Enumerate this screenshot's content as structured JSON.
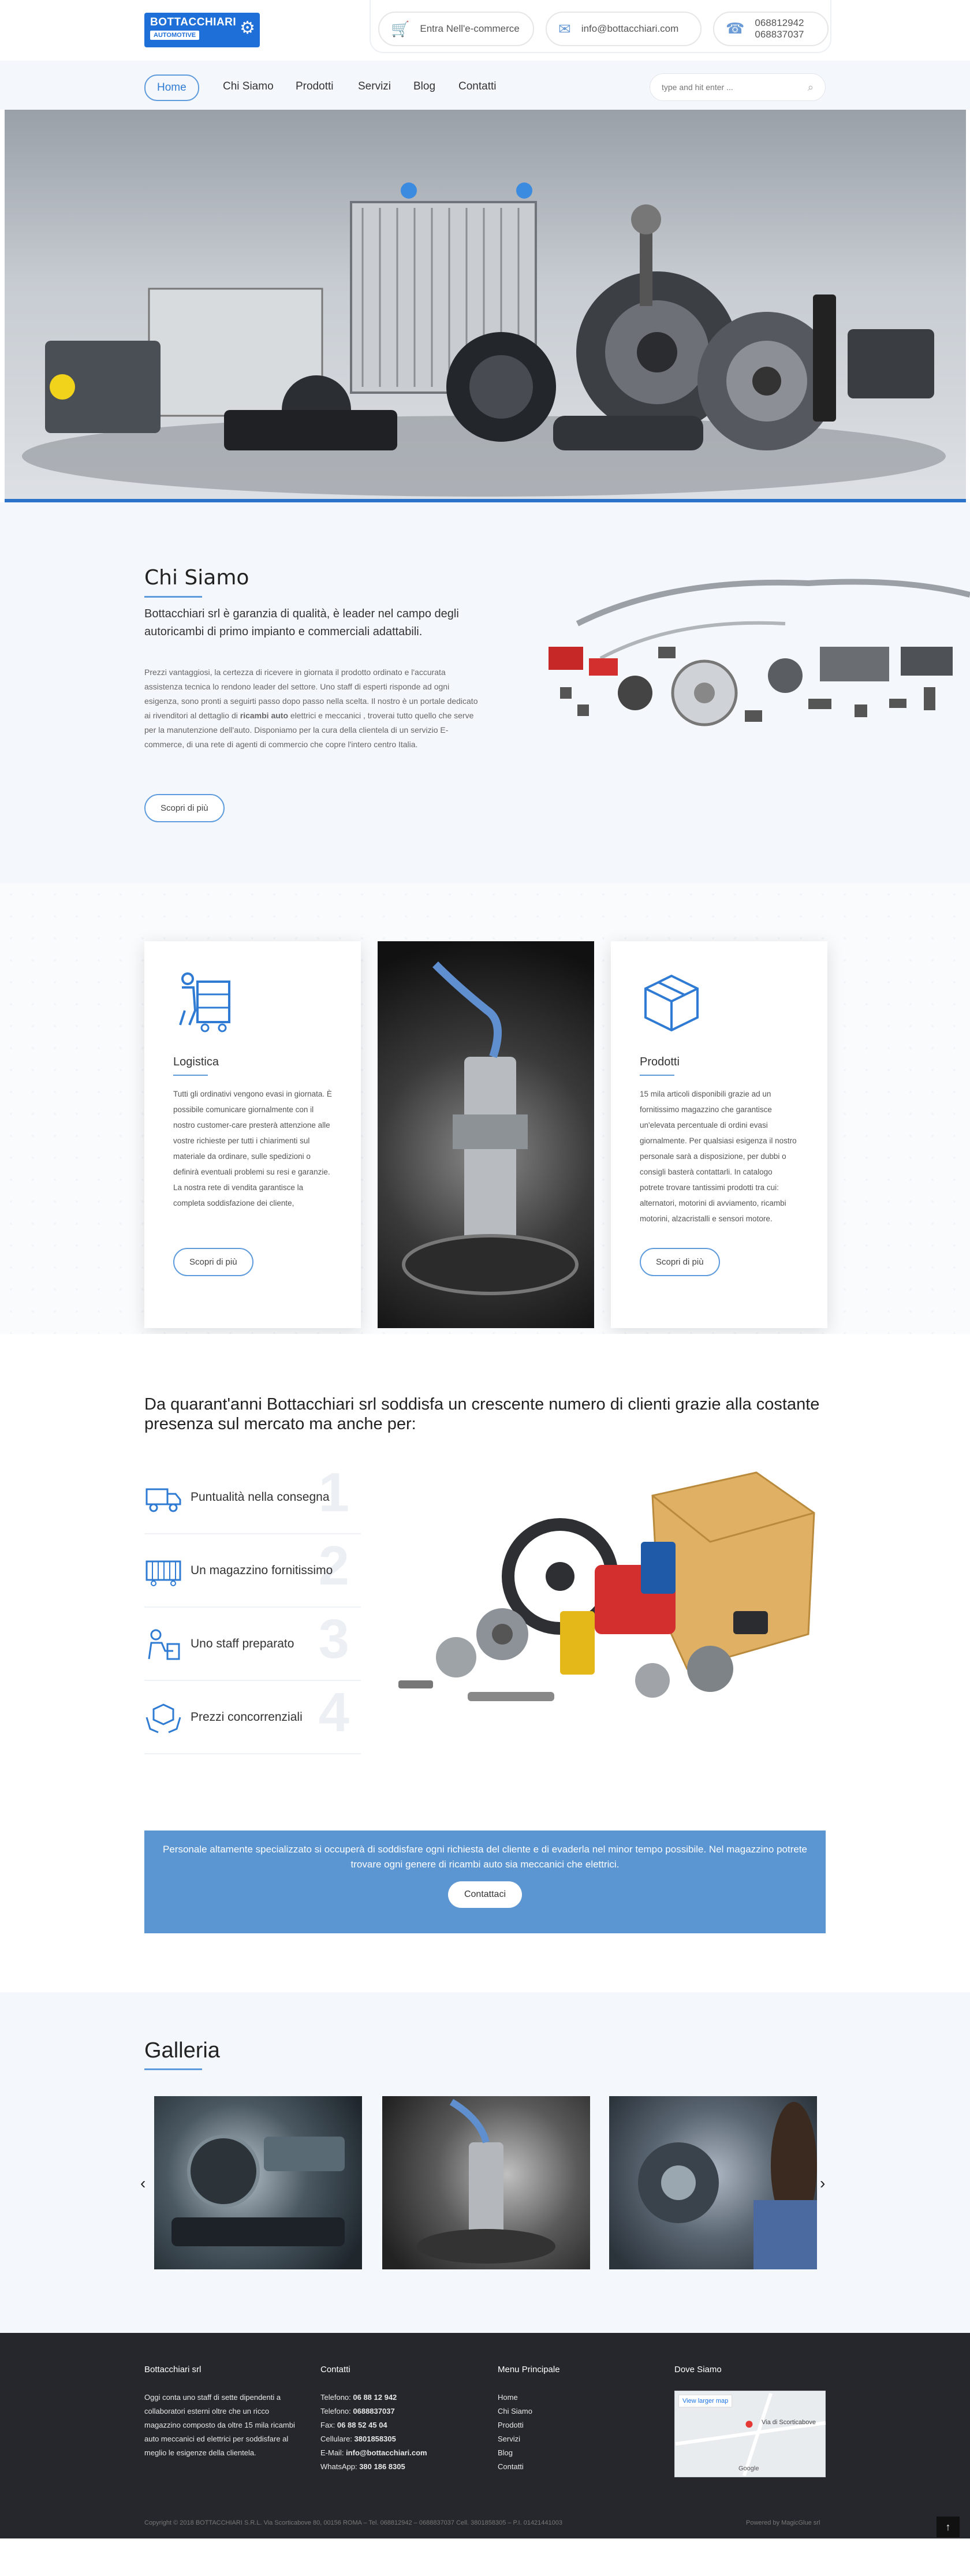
{
  "header": {
    "logo_line1": "BOTTACCHIARI",
    "logo_line2": "AUTOMOTIVE",
    "ecommerce_label": "Entra Nell'e-commerce",
    "email_label": "info@bottacchiari.com",
    "phone1": "068812942",
    "phone2": "068837037"
  },
  "nav": {
    "items": [
      "Home",
      "Chi Siamo",
      "Prodotti",
      "Servizi",
      "Blog",
      "Contatti"
    ],
    "search_placeholder": "type and hit enter ..."
  },
  "about": {
    "title": "Chi Siamo",
    "lead": "Bottacchiari srl è garanzia di qualità, è leader nel campo degli autoricambi di primo impianto e commerciali adattabili.",
    "body_start": "Prezzi vantaggiosi, la certezza di ricevere in giornata il prodotto ordinato e l'accurata assistenza tecnica lo rendono leader del settore. Uno staff di esperti risponde ad ogni esigenza, sono pronti a seguirti passo dopo passo nella scelta. Il nostro è un portale dedicato ai rivenditori al dettaglio di ",
    "body_bold": "ricambi auto",
    "body_end": " elettrici e meccanici , troverai tutto quello che serve per la manutenzione dell'auto. Disponiamo per la cura della clientela di un servizio E-commerce, di una rete di agenti di commercio che copre l'intero centro Italia.",
    "button": "Scopri di più"
  },
  "features": {
    "card1": {
      "title": "Logistica",
      "text": "Tutti gli ordinativi vengono evasi in giornata. È possibile comunicare giornalmente con il nostro customer-care presterà attenzione alle vostre richieste per tutti i chiarimenti sul materiale da ordinare, sulle spedizioni o definirà eventuali problemi su resi e garanzie. La nostra rete di vendita garantisce la completa soddisfazione dei cliente,",
      "button": "Scopri di più"
    },
    "card3": {
      "title": "Prodotti",
      "text": "15 mila articoli disponibili grazie ad un fornitissimo magazzino che garantisce un'elevata percentuale di ordini evasi giornalmente. Per qualsiasi esigenza il nostro personale sarà a disposizione, per dubbi o consigli basterà contattarli. In catalogo potrete trovare tantissimi prodotti tra cui: alternatori, motorini di avviamento, ricambi motorini, alzacristalli e sensori motore.",
      "button": "Scopri di più"
    }
  },
  "why": {
    "title": "Da quarant'anni Bottacchiari srl soddisfa un crescente numero di clienti grazie alla costante presenza sul mercato ma anche per:",
    "items": [
      {
        "label": "Puntualità nella consegna",
        "num": "1",
        "icon": "truck-icon"
      },
      {
        "label": "Un magazzino fornitissimo",
        "num": "2",
        "icon": "warehouse-icon"
      },
      {
        "label": "Uno staff preparato",
        "num": "3",
        "icon": "staff-icon"
      },
      {
        "label": "Prezzi concorrenziali",
        "num": "4",
        "icon": "box-hands-icon"
      }
    ]
  },
  "cta": {
    "text": "Personale altamente specializzato si occuperà di soddisfare ogni richiesta del cliente e di evaderla nel minor tempo possibile. Nel magazzino potrete trovare ogni genere di ricambi auto sia meccanici che elettrici.",
    "button": "Contattaci"
  },
  "gallery": {
    "title": "Galleria"
  },
  "footer": {
    "col1_title": "Bottacchiari srl",
    "col1_text": "Oggi conta uno staff di sette dipendenti a collaboratori esterni oltre che un ricco magazzino composto da oltre 15 mila ricambi auto meccanici ed elettrici per soddisfare al meglio le esigenze della clientela.",
    "col2_title": "Contatti",
    "contacts": [
      {
        "label": "Telefono: ",
        "value": "06 88 12 942"
      },
      {
        "label": "Telefono: ",
        "value": "0688837037"
      },
      {
        "label": "Fax: ",
        "value": "06 88 52 45 04"
      },
      {
        "label": "Cellulare: ",
        "value": "3801858305"
      },
      {
        "label": "E-Mail: ",
        "value": "info@bottacchiari.com"
      },
      {
        "label": "WhatsApp: ",
        "value": "380 186 8305"
      }
    ],
    "col3_title": "Menu Principale",
    "menu": [
      "Home",
      "Chi Siamo",
      "Prodotti",
      "Servizi",
      "Blog",
      "Contatti"
    ],
    "col4_title": "Dove Siamo",
    "map_button": "View larger map",
    "map_label": "Via di Scorticabove",
    "map_brand": "Google",
    "copyright": "Copyright © 2018 BOTTACCHIARI S.R.L. Via Scorticabove 80, 00156 ROMA – Tel. 068812942 – 0688837037 Cell. 3801858305 – P.I. 01421441003",
    "powered": "Powered by MagicGlue srl"
  },
  "colors": {
    "brand_blue": "#1f6fd8",
    "accent_blue": "#5d9bdc",
    "cta_blue": "#5b96d2",
    "footer_bg": "#25272c"
  }
}
